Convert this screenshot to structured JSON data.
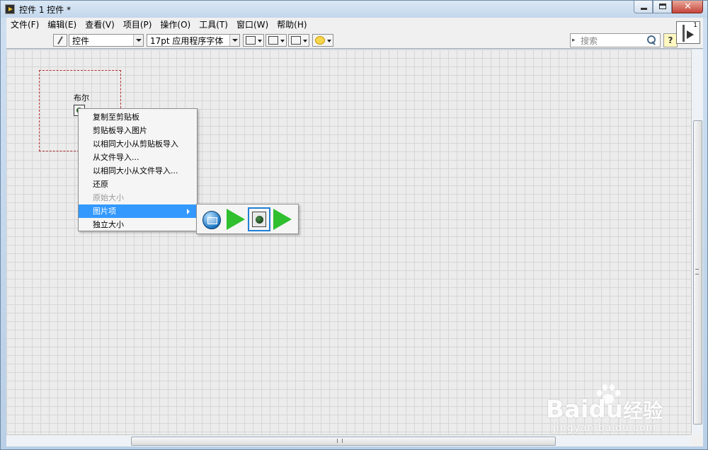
{
  "window": {
    "title": "控件 1 控件 *",
    "buttons": [
      "minimize",
      "maximize",
      "close"
    ]
  },
  "menubar": {
    "items": [
      "文件(F)",
      "编辑(E)",
      "查看(V)",
      "项目(P)",
      "操作(O)",
      "工具(T)",
      "窗口(W)",
      "帮助(H)"
    ]
  },
  "toolbar": {
    "control_dropdown": "控件",
    "font_dropdown": "17pt 应用程序字体",
    "align_icon": "align-objects-icon",
    "distribute_icon": "distribute-objects-icon",
    "resize_icon": "resize-objects-icon",
    "reorder_icon": "reorder-icon",
    "search_placeholder": "搜索",
    "help_label": "?",
    "connector_number": "1"
  },
  "canvas": {
    "control_label": "布尔"
  },
  "context_menu": {
    "items": [
      {
        "label": "复制至剪贴板",
        "state": "normal"
      },
      {
        "label": "剪贴板导入图片",
        "state": "normal"
      },
      {
        "label": "以相同大小从剪贴板导入",
        "state": "normal"
      },
      {
        "label": "从文件导入...",
        "state": "normal"
      },
      {
        "label": "以相同大小从文件导入...",
        "state": "normal"
      },
      {
        "label": "还原",
        "state": "normal"
      },
      {
        "label": "原始大小",
        "state": "disabled"
      },
      {
        "label": "图片项",
        "state": "active"
      },
      {
        "label": "独立大小",
        "state": "normal"
      }
    ],
    "highlight_color": "#3399ff"
  },
  "picture_submenu": {
    "items": [
      "globe-picture-icon",
      "green-arrow-icon",
      "led-picture-icon",
      "green-arrow-icon"
    ],
    "selected_index": 2
  },
  "watermark": {
    "brand": "Bai",
    "brand_suffix": "du",
    "cn_text": "经验",
    "url": "jingyan.baidu.com"
  }
}
